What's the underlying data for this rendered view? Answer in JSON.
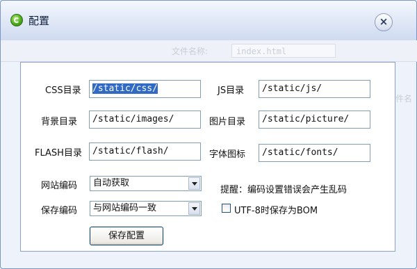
{
  "window": {
    "title": "配置",
    "close_glyph": "×"
  },
  "background": {
    "filename_label": "文件名称:",
    "filename_value": "index.html",
    "filename_label2": "文件名称"
  },
  "form": {
    "css_label": "CSS目录",
    "css_value": "/static/css/",
    "js_label": "JS目录",
    "js_value": "/static/js/",
    "bg_label": "背景目录",
    "bg_value": "/static/images/",
    "img_label": "图片目录",
    "img_value": "/static/picture/",
    "flash_label": "FLASH目录",
    "flash_value": "/static/flash/",
    "font_label": "字体图标",
    "font_value": "/static/fonts/",
    "site_encoding_label": "网站编码",
    "site_encoding_value": "自动获取",
    "save_encoding_label": "保存编码",
    "save_encoding_value": "与网站编码一致",
    "hint": "提醒：编码设置错误会产生乱码",
    "bom_label": "UTF-8时保存为BOM",
    "bom_checked": false,
    "save_button": "保存配置"
  },
  "icons": {
    "title": "app-logo-icon",
    "close": "close-icon",
    "dropdown": "chevron-down-icon"
  }
}
